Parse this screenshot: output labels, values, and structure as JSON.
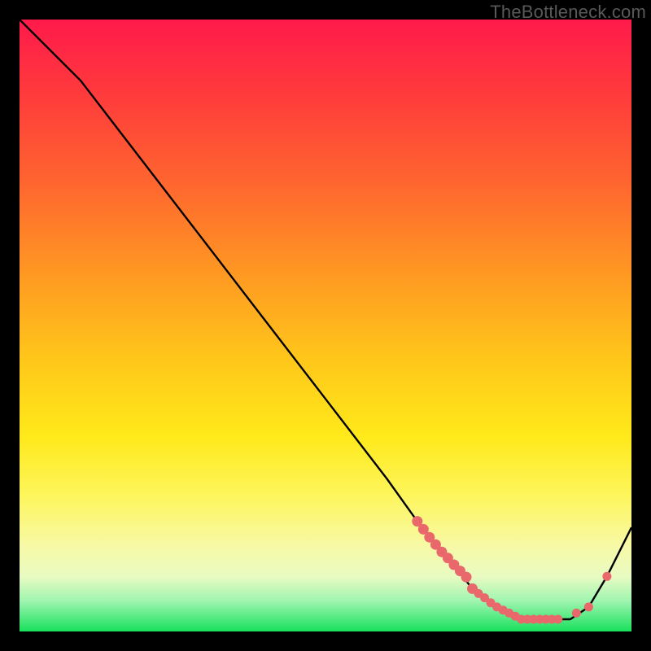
{
  "watermark": "TheBottleneck.com",
  "chart_data": {
    "type": "line",
    "title": "",
    "xlabel": "",
    "ylabel": "",
    "xlim": [
      0,
      100
    ],
    "ylim": [
      0,
      100
    ],
    "series": [
      {
        "name": "bottleneck-curve",
        "x": [
          0,
          6,
          10,
          20,
          30,
          40,
          50,
          60,
          65,
          70,
          74,
          78,
          82,
          86,
          90,
          93,
          96,
          100
        ],
        "values": [
          100,
          94,
          90,
          77,
          64,
          51,
          38,
          25,
          18,
          12,
          7,
          4,
          2,
          2,
          2,
          4,
          9,
          17
        ]
      }
    ],
    "markers": {
      "name": "highlight-dots",
      "color": "#e9686c",
      "x": [
        65,
        66,
        67,
        68,
        69,
        70,
        71,
        72,
        73,
        74,
        75,
        76,
        77,
        78,
        79,
        80,
        81,
        82,
        83,
        84,
        85,
        86,
        87,
        88,
        91,
        93,
        96
      ],
      "values": [
        18,
        16.7,
        15.4,
        14.2,
        13.0,
        12.0,
        10.9,
        9.9,
        8.9,
        7.0,
        6.2,
        5.5,
        4.7,
        4.0,
        3.5,
        3.0,
        2.5,
        2.0,
        2.0,
        2.0,
        2.0,
        2.0,
        2.0,
        2.0,
        3.0,
        4.0,
        9.0
      ]
    }
  }
}
